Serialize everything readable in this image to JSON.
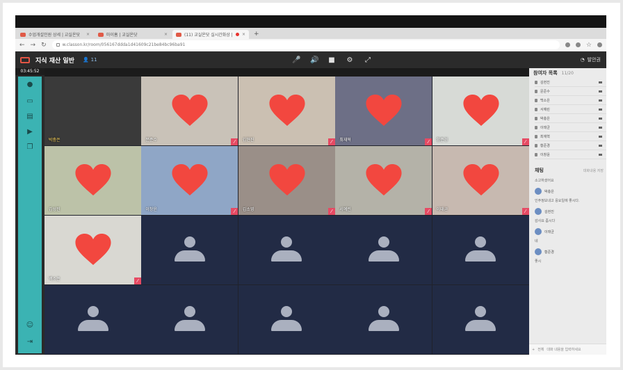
{
  "browser": {
    "tabs": [
      {
        "label": "수업개설인원 상세 | 교실온닷",
        "active": false,
        "recording": false
      },
      {
        "label": "마이홈 | 교실온닷",
        "active": false,
        "recording": false
      },
      {
        "label": "(11) 교실온닷 실시간화상 |",
        "active": true,
        "recording": true
      }
    ],
    "new_tab": "+",
    "url": "w.classon.kr/room/056167ddda1d41609c21be84bc96ba91"
  },
  "app": {
    "title": "지식 재산 일반",
    "participant_count": "11",
    "timer": "03:45:52",
    "user_name": "발안권",
    "colors": {
      "accent": "#3bb3b3",
      "brand": "#e35545",
      "mic_off": "#e64a63",
      "empty_tile": "#222b45"
    }
  },
  "tiles": [
    {
      "name": "박충은",
      "kind": "video",
      "star": true,
      "bg": "#3a3a3a",
      "heart": false
    },
    {
      "name": "문준수",
      "kind": "video",
      "bg": "#c9c2b8",
      "heart": true
    },
    {
      "name": "김현진",
      "kind": "video",
      "bg": "#cbc0b2",
      "heart": true
    },
    {
      "name": "최재혁",
      "kind": "video",
      "bg": "#6d6f86",
      "heart": true
    },
    {
      "name": "황준경",
      "kind": "video",
      "bg": "#d7dad6",
      "heart": true
    },
    {
      "name": "김성진",
      "kind": "video",
      "bg": "#bcc2a8",
      "heart": true
    },
    {
      "name": "이창윤",
      "kind": "video",
      "bg": "#8fa6c6",
      "heart": true
    },
    {
      "name": "김소영",
      "kind": "video",
      "bg": "#9a8f88",
      "heart": true
    },
    {
      "name": "서예린",
      "kind": "video",
      "bg": "#b4b2a8",
      "heart": true
    },
    {
      "name": "이태균",
      "kind": "video",
      "bg": "#c7b9b0",
      "heart": true
    },
    {
      "name": "백소은",
      "kind": "video",
      "bg": "#d9d8d2",
      "heart": true
    },
    {
      "name": "",
      "kind": "empty"
    },
    {
      "name": "",
      "kind": "empty"
    },
    {
      "name": "",
      "kind": "empty"
    },
    {
      "name": "",
      "kind": "empty"
    },
    {
      "name": "",
      "kind": "empty"
    },
    {
      "name": "",
      "kind": "empty"
    },
    {
      "name": "",
      "kind": "empty"
    },
    {
      "name": "",
      "kind": "empty"
    },
    {
      "name": "",
      "kind": "empty"
    }
  ],
  "participants": {
    "title": "참여자 목록",
    "count": "11/20",
    "items": [
      "김현진",
      "문준수",
      "백소은",
      "서예린",
      "박충은",
      "이태균",
      "최재혁",
      "황준경",
      "이창윤"
    ]
  },
  "chat": {
    "title": "채팅",
    "hint": "대화내용 저장",
    "messages": [
      {
        "author": "",
        "text": "소고하셨어요"
      },
      {
        "author": "박충은",
        "text": "인주정보내고 응요일에 좋시다."
      },
      {
        "author": "김현진",
        "text": "감사요 좀시다"
      },
      {
        "author": "이태균",
        "text": "네"
      },
      {
        "author": "황준경",
        "text": "좋시"
      }
    ],
    "target": "전체",
    "placeholder": "대화 내용을 입력하세요"
  }
}
